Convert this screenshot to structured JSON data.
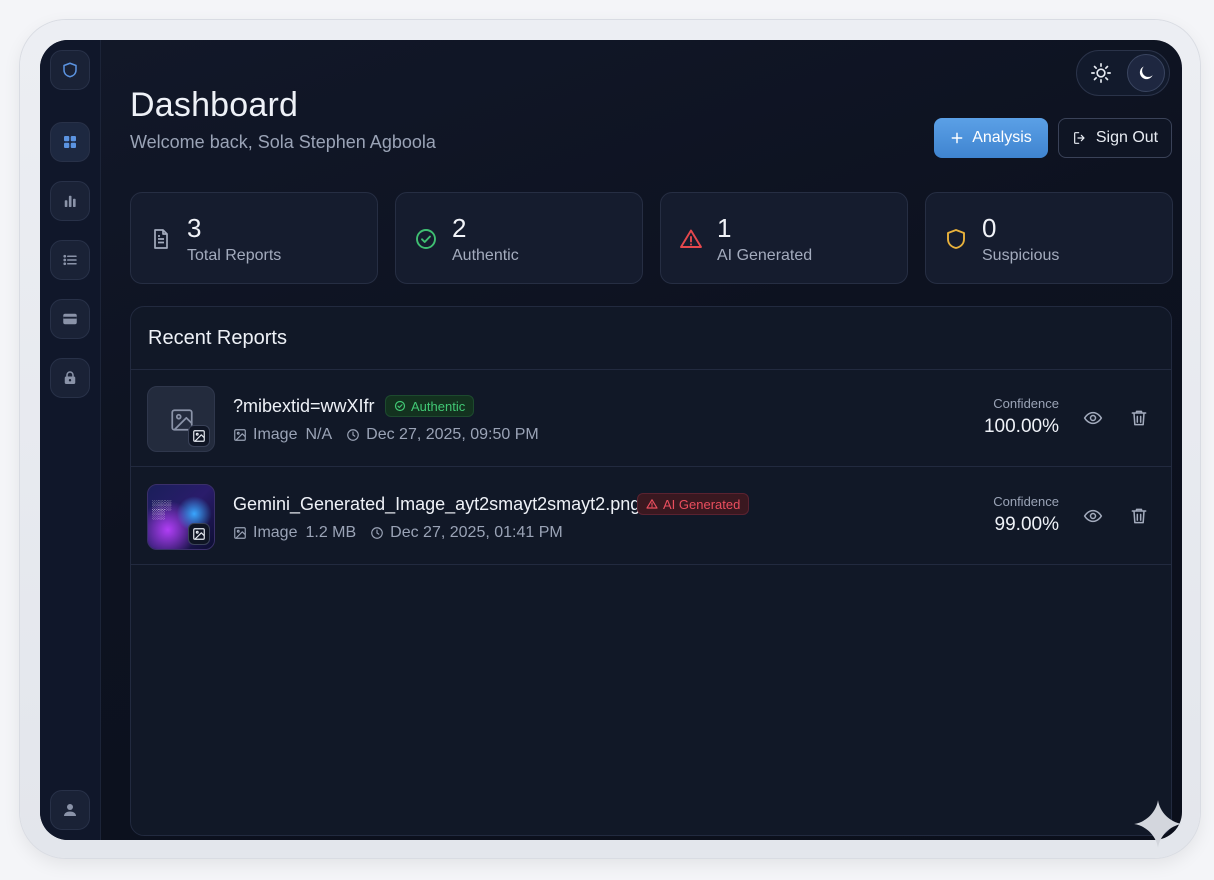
{
  "header": {
    "title": "Dashboard",
    "subtitle": "Welcome back, Sola Stephen Agboola"
  },
  "actions": {
    "analysis_label": "Analysis",
    "signout_label": "Sign Out"
  },
  "sidebar": {
    "items": [
      {
        "icon": "shield-icon"
      },
      {
        "icon": "grid-icon",
        "active": true
      },
      {
        "icon": "bar-chart-icon"
      },
      {
        "icon": "list-icon"
      },
      {
        "icon": "credit-card-icon"
      },
      {
        "icon": "lock-icon"
      },
      {
        "icon": "user-icon"
      }
    ]
  },
  "theme": {
    "options": [
      "sun-icon",
      "moon-icon"
    ],
    "selected": "moon-icon"
  },
  "stats": [
    {
      "value": "3",
      "label": "Total Reports",
      "icon": "document-icon",
      "color": "#a3abbd"
    },
    {
      "value": "2",
      "label": "Authentic",
      "icon": "check-circle-icon",
      "color": "#3fbf72"
    },
    {
      "value": "1",
      "label": "AI Generated",
      "icon": "warning-icon",
      "color": "#e5484d"
    },
    {
      "value": "0",
      "label": "Suspicious",
      "icon": "shield-icon",
      "color": "#e9b23c"
    }
  ],
  "reports": {
    "title": "Recent Reports",
    "confidence_label": "Confidence",
    "rows": [
      {
        "name": "?mibextid=wwXIfr",
        "status": "Authentic",
        "type": "Image",
        "size": "N/A",
        "date": "Dec 27, 2025, 09:50 PM",
        "confidence": "100.00%"
      },
      {
        "name": "Gemini_Generated_Image_ayt2smayt2smayt2.png",
        "status": "AI Generated",
        "type": "Image",
        "size": "1.2 MB",
        "date": "Dec 27, 2025, 01:41 PM",
        "confidence": "99.00%"
      }
    ]
  },
  "colors": {
    "accent": "#4a90dc",
    "authentic": "#41c774",
    "ai_generated": "#ea4e5e",
    "suspicious": "#e9b23c"
  }
}
